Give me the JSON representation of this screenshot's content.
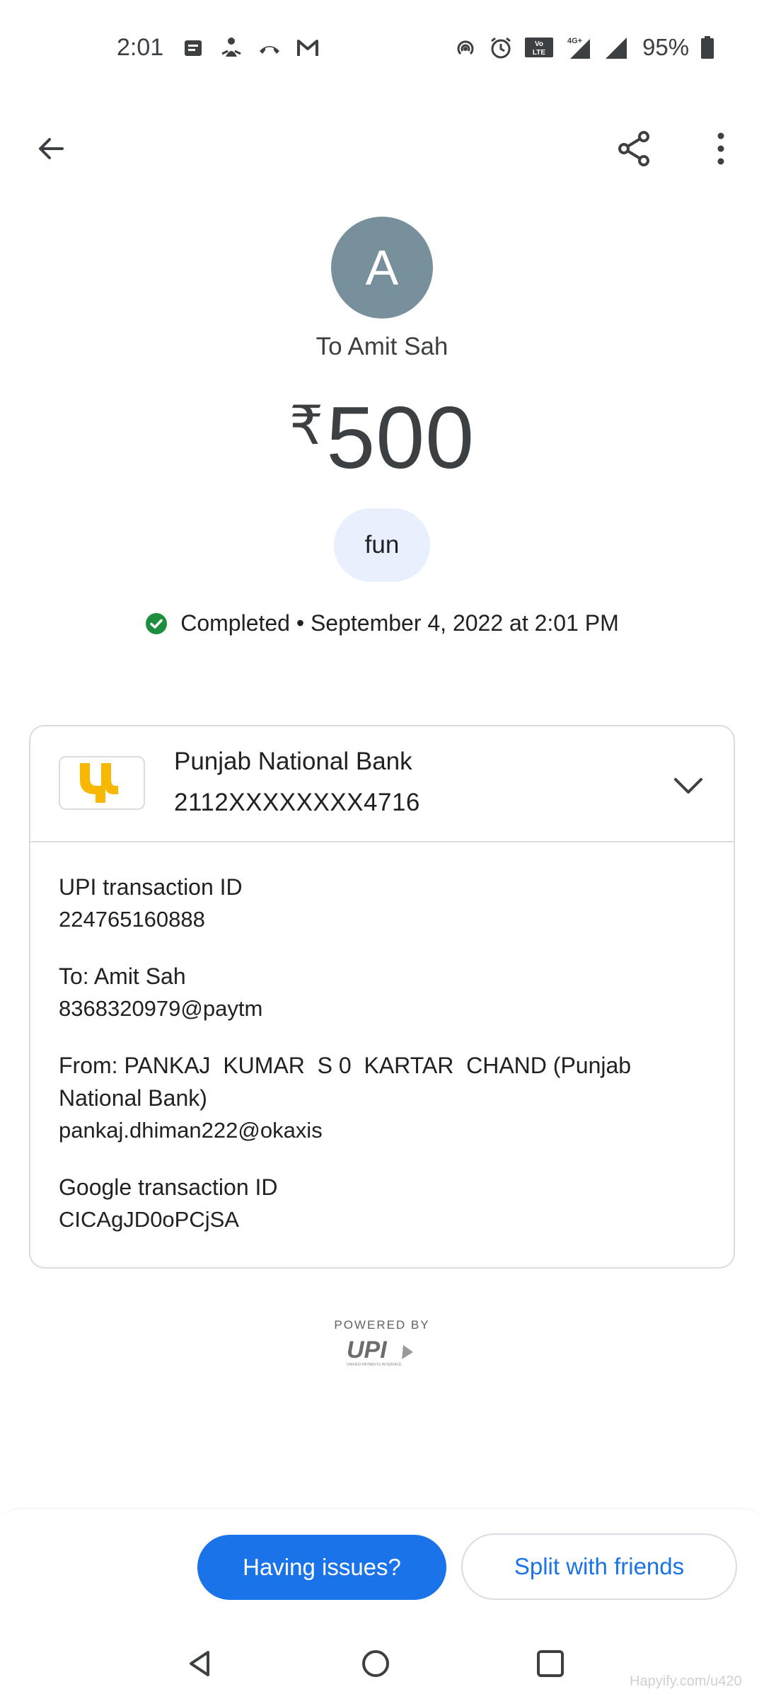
{
  "status_bar": {
    "time": "2:01",
    "battery": "95%",
    "notification_icons": [
      "message-icon",
      "meditation-icon",
      "missed-call-icon",
      "gmail-icon"
    ],
    "system_icons": [
      "hotspot-icon",
      "alarm-icon",
      "volte-icon",
      "4g-signal-icon",
      "signal-icon",
      "battery-icon"
    ],
    "network_label": "4G+",
    "volte_label": "VoLTE"
  },
  "app_bar": {
    "back_icon": "arrow-back-icon",
    "share_icon": "share-icon",
    "more_icon": "more-vert-icon"
  },
  "transaction": {
    "avatar_letter": "A",
    "recipient_line": "To Amit Sah",
    "currency_symbol": "₹",
    "amount": "500",
    "note": "fun",
    "status_text": "Completed • September 4, 2022 at 2:01 PM",
    "status_color": "#1e8e3e"
  },
  "bank": {
    "name": "Punjab National Bank",
    "account": "2112XXXXXXXX4716",
    "logo_color": "#f9b800"
  },
  "details": [
    {
      "label": "UPI transaction ID",
      "value": "224765160888"
    },
    {
      "label": "To: Amit Sah",
      "value": "8368320979@paytm"
    },
    {
      "label": "From: PANKAJ  KUMAR  S 0  KARTAR  CHAND (Punjab National Bank)",
      "value": "pankaj.dhiman222@okaxis"
    },
    {
      "label": "Google transaction ID",
      "value": "CICAgJD0oPCjSA"
    }
  ],
  "footer": {
    "powered_by": "POWERED BY",
    "upi_logo_text": "UPI",
    "upi_subtext": "UNIFIED PAYMENTS INTERFACE"
  },
  "actions": {
    "primary": "Having issues?",
    "secondary": "Split with friends"
  },
  "nav": {
    "back": "nav-back-icon",
    "home": "nav-home-icon",
    "recents": "nav-recents-icon"
  },
  "watermark": "Hapyify.com/u420",
  "colors": {
    "accent": "#1a73e8",
    "avatar": "#78909c",
    "chip": "#e8f0fe",
    "border": "#dadce0"
  }
}
